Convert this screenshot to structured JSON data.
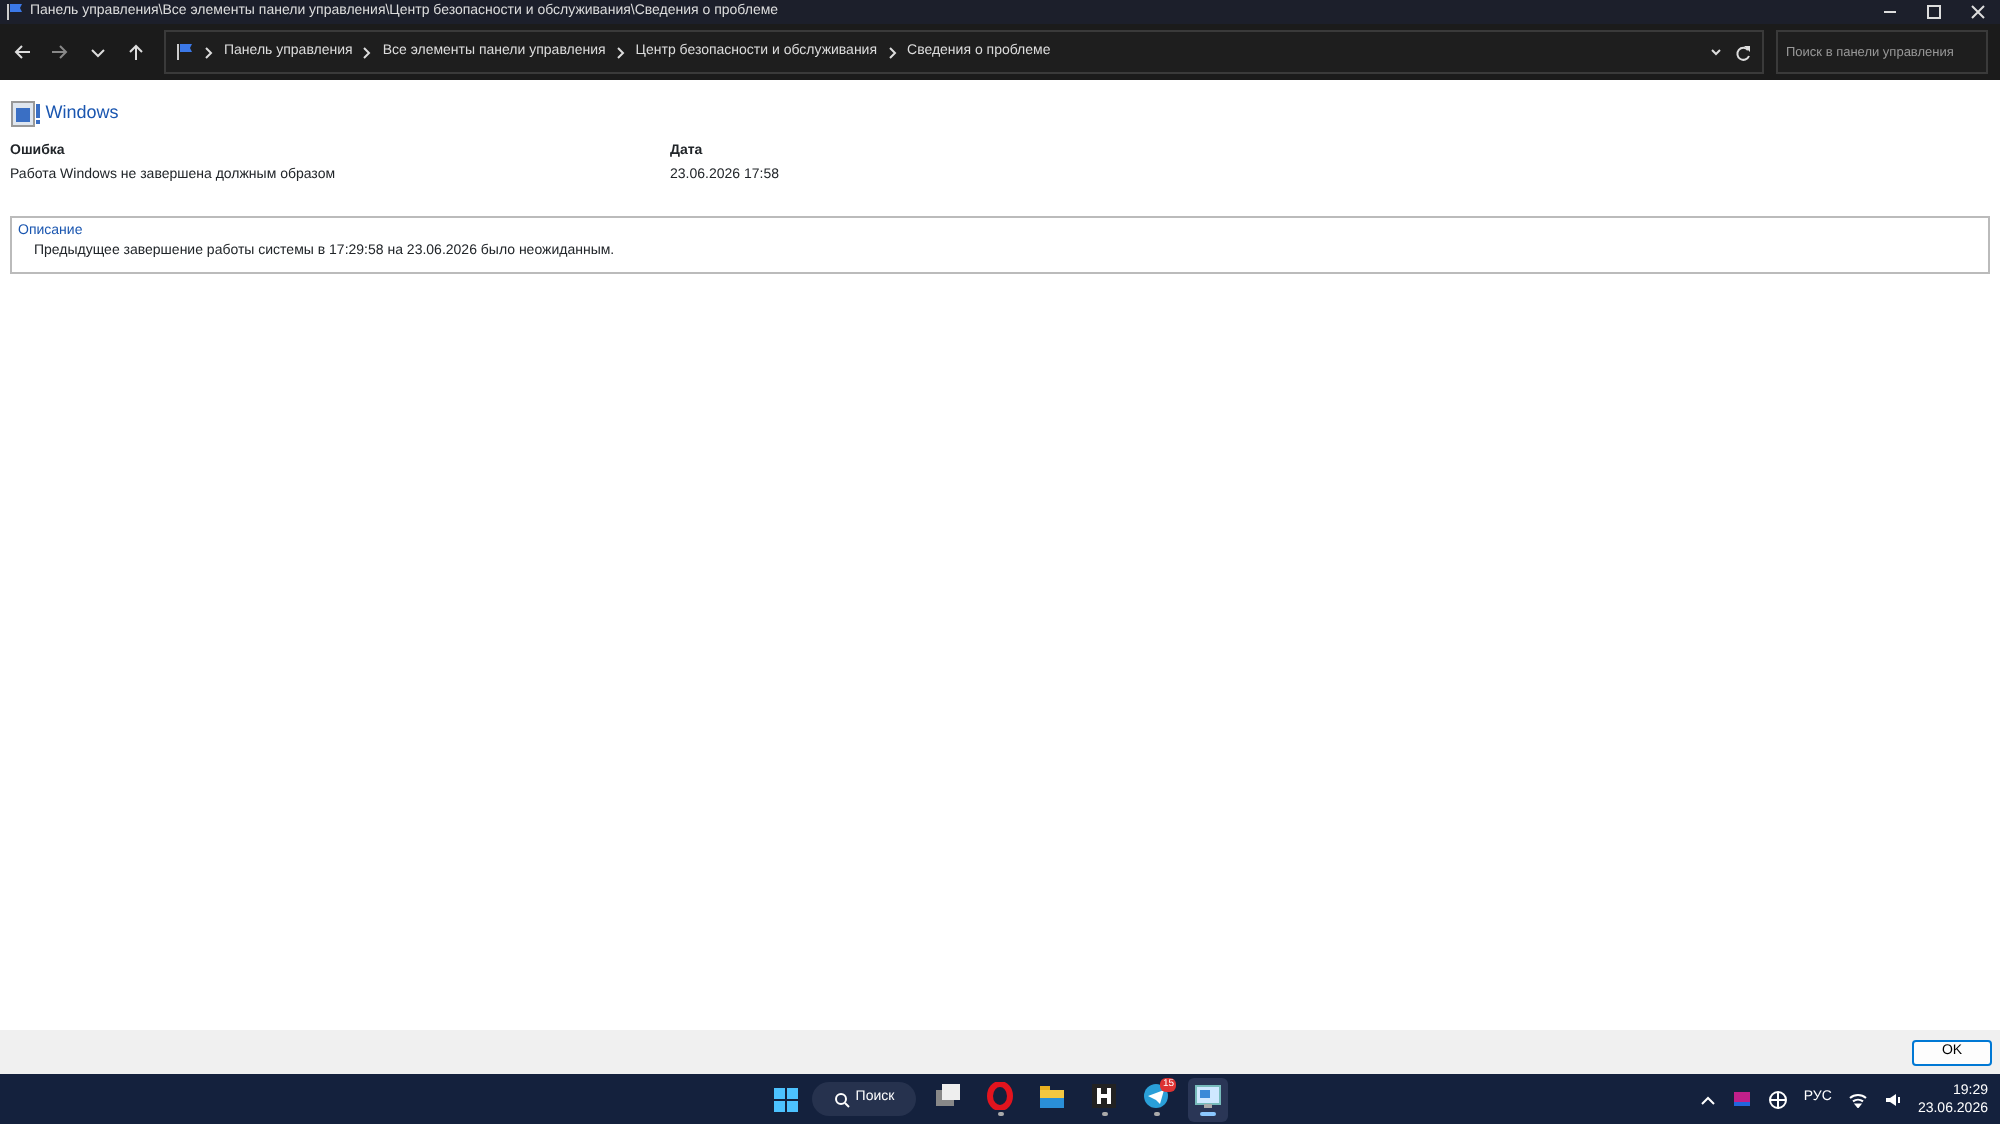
{
  "window": {
    "title": "Панель управления\\Все элементы панели управления\\Центр безопасности и обслуживания\\Сведения о проблеме"
  },
  "address_bar": {
    "crumbs": [
      "Панель управления",
      "Все элементы панели управления",
      "Центр безопасности и обслуживания",
      "Сведения о проблеме"
    ]
  },
  "search": {
    "placeholder": "Поиск в панели управления"
  },
  "product": "Windows",
  "fields": [
    {
      "label": "Ошибка",
      "value": "Работа Windows не завершена должным образом"
    },
    {
      "label": "Дата",
      "value": "23.06.2026 17:58"
    }
  ],
  "description": {
    "label": "Описание",
    "text": "Предыдущее завершение работы системы в 17:29:58 на 23.06.2026 было неожиданным."
  },
  "buttons": [
    "OK"
  ],
  "taskbar": {
    "search_label": "Поиск",
    "apps": [
      {
        "kind": "taskview",
        "running": false,
        "active": false
      },
      {
        "kind": "opera",
        "running": true,
        "active": false
      },
      {
        "kind": "folder",
        "running": false,
        "active": false
      },
      {
        "kind": "hletter",
        "running": true,
        "active": false
      },
      {
        "kind": "telegram",
        "running": true,
        "active": false,
        "badge": "15"
      },
      {
        "kind": "monitor",
        "running": true,
        "active": true
      }
    ],
    "language": "РУС",
    "time": "19:29",
    "date": "23.06.2026"
  }
}
